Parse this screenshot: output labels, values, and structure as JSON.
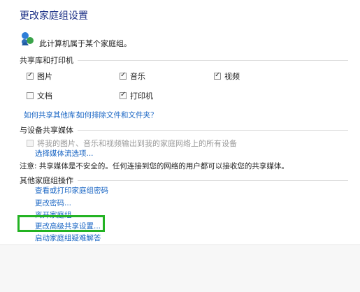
{
  "page": {
    "title": "更改家庭组设置",
    "intro": "此计算机属于某个家庭组。"
  },
  "sharing": {
    "header": "共享库和打印机",
    "items": [
      {
        "label": "图片",
        "checked": true
      },
      {
        "label": "音乐",
        "checked": true
      },
      {
        "label": "视频",
        "checked": true
      },
      {
        "label": "文档",
        "checked": false
      },
      {
        "label": "打印机",
        "checked": true
      }
    ],
    "links": [
      "如何共享其他库？",
      "如何排除文件和文件夹？"
    ]
  },
  "media": {
    "header": "与设备共享媒体",
    "checkbox_label": "将我的图片、音乐和视频输出到我的家庭网络上的所有设备",
    "link": "选择媒体流选项...",
    "note": "注意: 共享媒体是不安全的。任何连接到您的网络的用户都可以接收您的共享媒体。"
  },
  "other": {
    "header": "其他家庭组操作",
    "links": [
      "查看或打印家庭组密码",
      "更改密码...",
      "离开家庭组...",
      "更改高级共享设置...",
      "启动家庭组疑难解答"
    ]
  }
}
